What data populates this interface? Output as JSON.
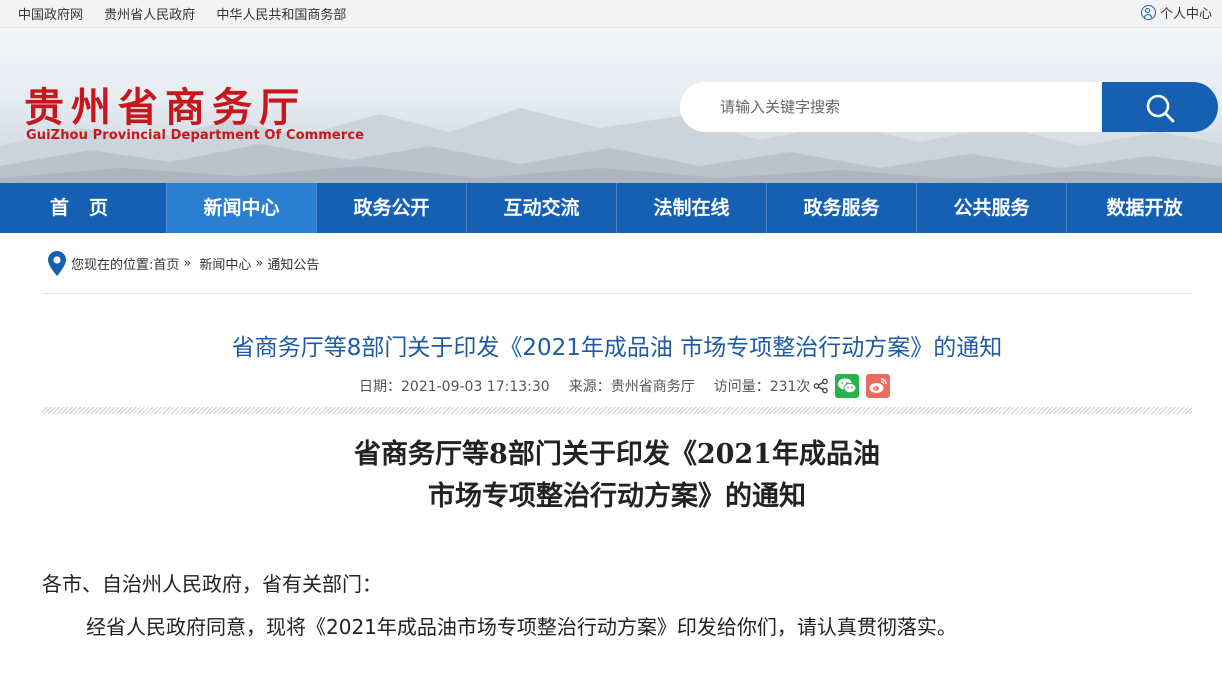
{
  "topbar": {
    "links": [
      "中国政府网",
      "贵州省人民政府",
      "中华人民共和国商务部"
    ],
    "user_label": "个人中心"
  },
  "header": {
    "logo_cn": "贵州省商务厅",
    "logo_en": "GuiZhou Provincial Department Of Commerce",
    "search_placeholder": "请输入关键字搜索"
  },
  "nav": {
    "items": [
      "首页",
      "新闻中心",
      "政务公开",
      "互动交流",
      "法制在线",
      "政务服务",
      "公共服务",
      "数据开放"
    ],
    "active": "新闻中心"
  },
  "breadcrumb": {
    "prefix": "您现在的位置:",
    "home": "首页",
    "sep": "»",
    "section": "新闻中心",
    "current": "通知公告"
  },
  "article": {
    "title": "省商务厅等8部门关于印发《2021年成品油 市场专项整治行动方案》的通知",
    "date": "日期：2021-09-03 17:13:30",
    "source": "来源：贵州省商务厅",
    "visits": "访问量：231次",
    "body_title_line1": "省商务厅等8部门关于印发《2021年成品油",
    "body_title_line2": "市场专项整治行动方案》的通知",
    "salutation": "各市、自治州人民政府，省有关部门：",
    "paragraph1": "经省人民政府同意，现将《2021年成品油市场专项整治行动方案》印发给你们，请认真贯彻落实。"
  },
  "colors": {
    "brand_red": "#c8161d",
    "nav_blue": "#1560b3",
    "nav_active": "#2b7fd0",
    "title_blue": "#1f5aa6",
    "wechat_green": "#26b44a",
    "weibo_red": "#ec6b5c"
  },
  "icons": [
    "user-icon",
    "search-icon",
    "location-pin-icon",
    "share-icon",
    "wechat-icon",
    "weibo-icon"
  ]
}
